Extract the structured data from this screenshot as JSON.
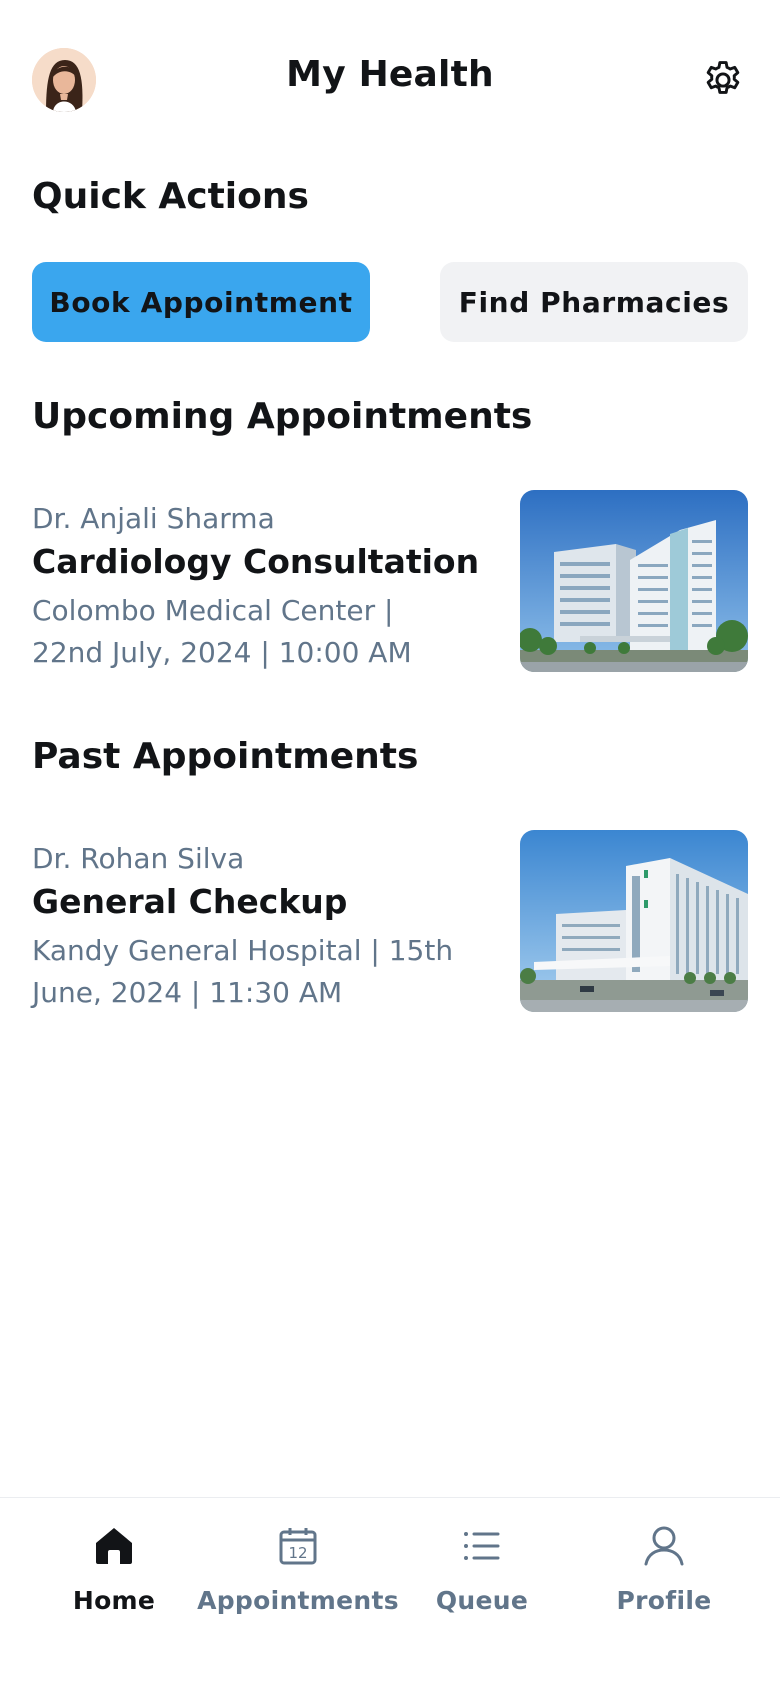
{
  "header": {
    "title": "My Health",
    "avatar_icon": "user-avatar",
    "settings_icon": "gear-icon"
  },
  "quick_actions": {
    "title": "Quick Actions",
    "primary_label": "Book Appointment",
    "secondary_label": "Find Pharmacies"
  },
  "upcoming": {
    "title": "Upcoming Appointments",
    "items": [
      {
        "doctor": "Dr. Anjali Sharma",
        "title": "Cardiology Consultation",
        "details": "Colombo Medical Center | 22nd July, 2024 | 10:00 AM"
      }
    ]
  },
  "past": {
    "title": "Past Appointments",
    "items": [
      {
        "doctor": "Dr. Rohan Silva",
        "title": "General Checkup",
        "details": "Kandy General Hospital | 15th June, 2024 | 11:30 AM"
      }
    ]
  },
  "nav": {
    "items": [
      {
        "label": "Home",
        "icon": "home-icon",
        "active": true
      },
      {
        "label": "Appointments",
        "icon": "calendar-icon",
        "calendar_day": "12",
        "active": false
      },
      {
        "label": "Queue",
        "icon": "list-icon",
        "active": false
      },
      {
        "label": "Profile",
        "icon": "user-icon",
        "active": false
      }
    ]
  },
  "colors": {
    "accent": "#3aa6ee",
    "secondary_button": "#f1f2f4",
    "text_primary": "#121417",
    "text_secondary": "#61758a"
  }
}
